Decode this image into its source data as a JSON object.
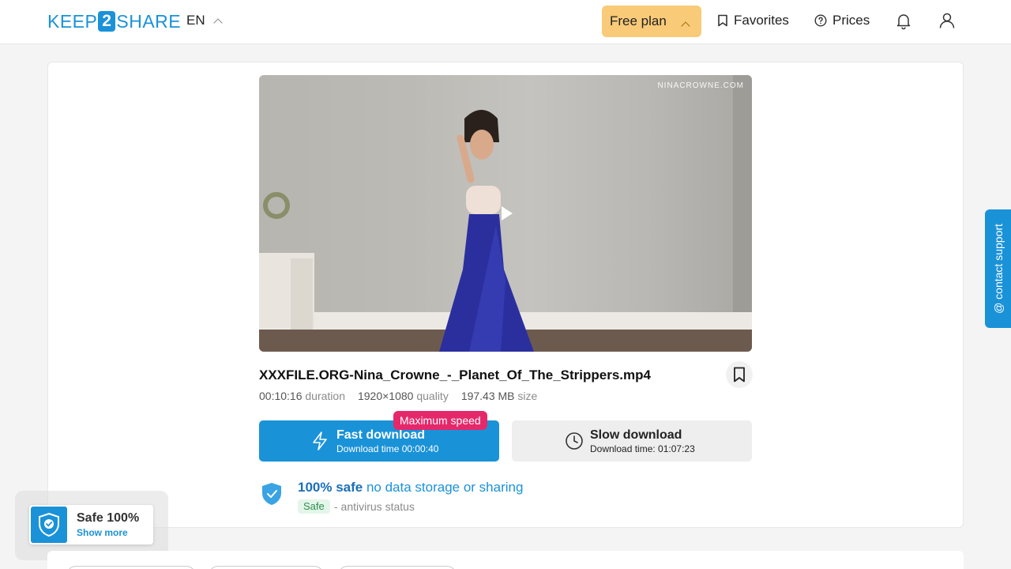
{
  "header": {
    "logo": {
      "part1": "KEEP",
      "part2": "2",
      "part3": "SHARE"
    },
    "language": "EN",
    "plan_label": "Free plan",
    "favorites_label": "Favorites",
    "prices_label": "Prices"
  },
  "video": {
    "watermark": "NINACROWNE.COM"
  },
  "file": {
    "name": "XXXFILE.ORG-Nina_Crowne_-_Planet_Of_The_Strippers.mp4",
    "duration_value": "00:10:16",
    "duration_label": "duration",
    "quality_value": "1920×1080",
    "quality_label": "quality",
    "size_value": "197.43 MB",
    "size_label": "size"
  },
  "download": {
    "fast_label": "Fast download",
    "fast_time": "Download time 00:00:40",
    "max_speed_badge": "Maximum speed",
    "slow_label": "Slow download",
    "slow_time": "Download time: 01:07:23"
  },
  "safety": {
    "strong": "100% safe",
    "rest": "no data storage or sharing",
    "badge": "Safe",
    "antivirus": "- antivirus status"
  },
  "support_tab": "@ contact support",
  "widget": {
    "title": "Safe 100%",
    "link": "Show more"
  },
  "colors": {
    "brand": "#1a92d8",
    "plan": "#f9ca78",
    "max_speed": "#e5286a",
    "safe_green": "#2e8f4d"
  }
}
